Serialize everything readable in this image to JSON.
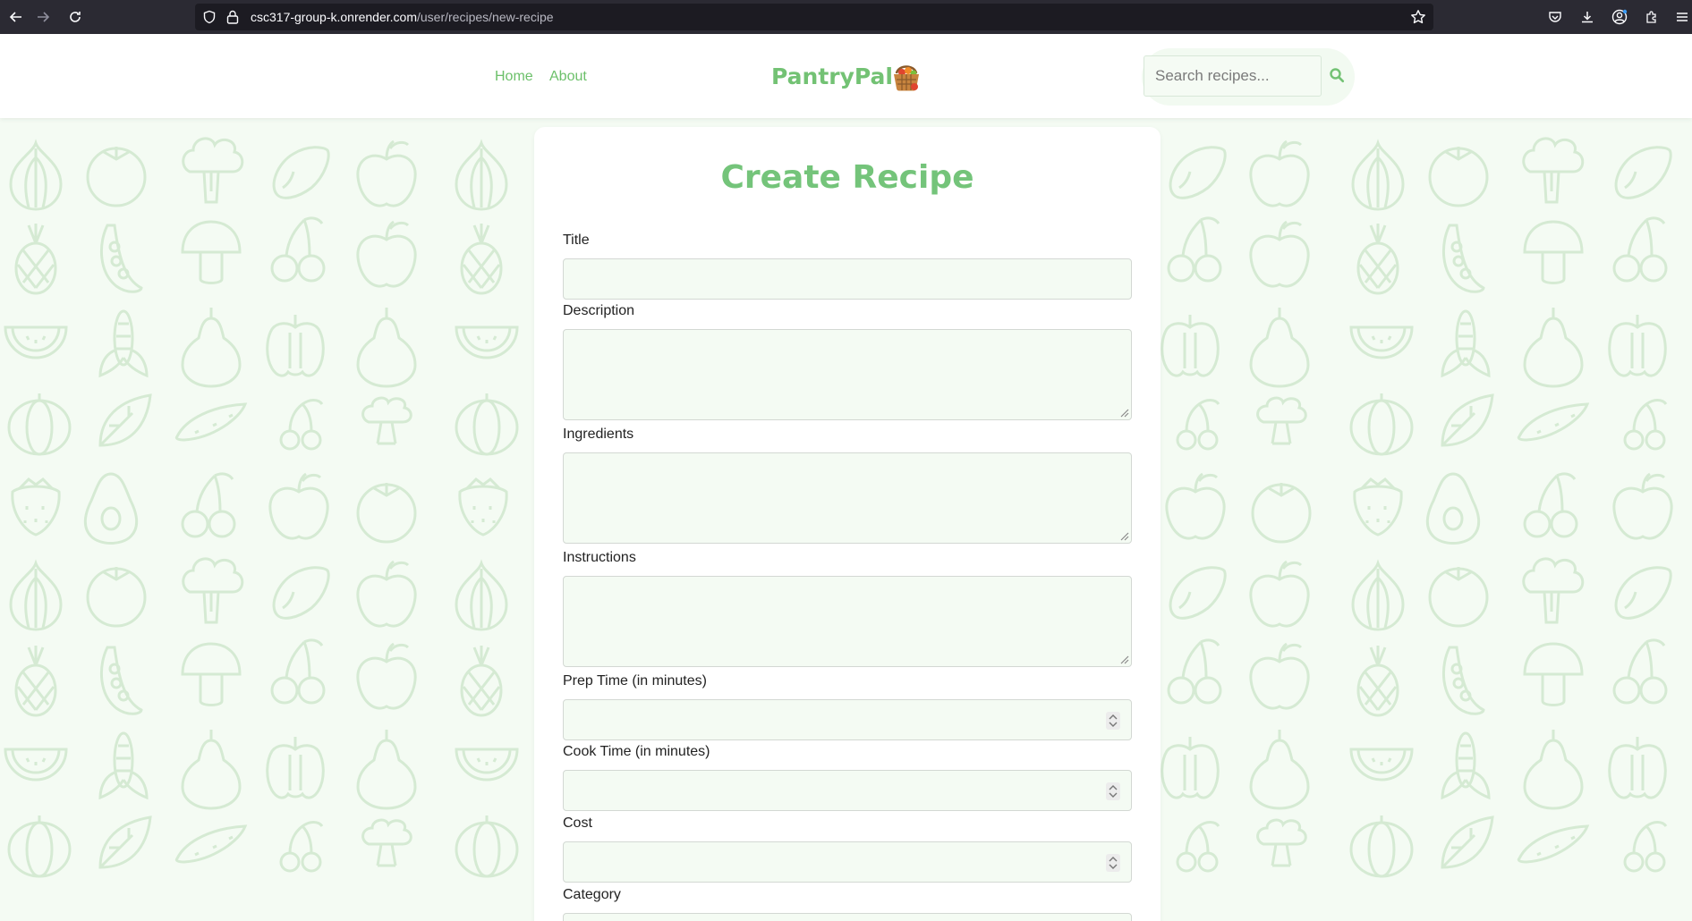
{
  "browser": {
    "url_host": "csc317-group-k.onrender.com",
    "url_path": "/user/recipes/new-recipe"
  },
  "header": {
    "nav": [
      {
        "label": "Home"
      },
      {
        "label": "About"
      }
    ],
    "brand": "PantryPal",
    "search": {
      "placeholder": "Search recipes...",
      "value": ""
    }
  },
  "form": {
    "title": "Create Recipe",
    "fields": [
      {
        "label": "Title",
        "type": "text",
        "value": ""
      },
      {
        "label": "Description",
        "type": "textarea",
        "value": ""
      },
      {
        "label": "Ingredients",
        "type": "textarea",
        "value": ""
      },
      {
        "label": "Instructions",
        "type": "textarea",
        "value": ""
      },
      {
        "label": "Prep Time (in minutes)",
        "type": "number",
        "value": ""
      },
      {
        "label": "Cook Time (in minutes)",
        "type": "number",
        "value": ""
      },
      {
        "label": "Cost",
        "type": "number",
        "value": ""
      },
      {
        "label": "Category",
        "type": "select",
        "value": ""
      }
    ]
  },
  "colors": {
    "brand_green": "#73c274",
    "page_bg": "#f4fbf3",
    "pattern_stroke": "#d5ead3"
  }
}
